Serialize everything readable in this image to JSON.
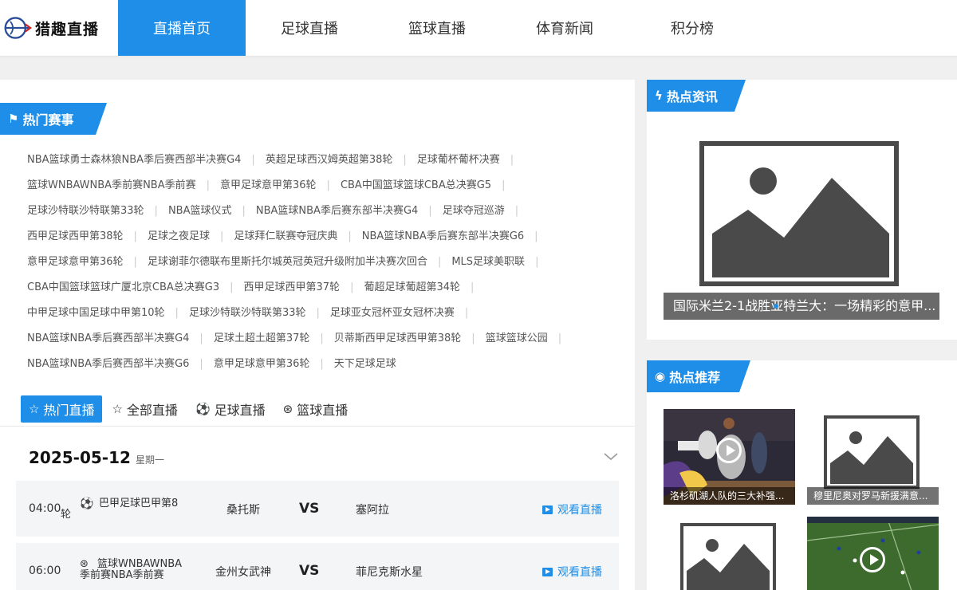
{
  "brand": {
    "name": "猎趣直播",
    "accent": "#1e8ee8"
  },
  "nav": [
    {
      "label": "直播首页",
      "active": true
    },
    {
      "label": "足球直播"
    },
    {
      "label": "篮球直播"
    },
    {
      "label": "体育新闻"
    },
    {
      "label": "积分榜"
    }
  ],
  "hot_events": {
    "title": "热门赛事",
    "lines": [
      [
        "NBA篮球勇士森林狼NBA季后赛西部半决赛G4",
        "英超足球西汉姆英超第38轮",
        "足球葡杯葡杯决赛"
      ],
      [
        "篮球WNBAWNBA季前赛NBA季前赛",
        "意甲足球意甲第36轮",
        "CBA中国篮球篮球CBA总决赛G5"
      ],
      [
        "足球沙特联沙特联第33轮",
        "NBA篮球仪式",
        "NBA篮球NBA季后赛东部半决赛G4",
        "足球夺冠巡游"
      ],
      [
        "西甲足球西甲第38轮",
        "足球之夜足球",
        "足球拜仁联赛夺冠庆典",
        "NBA篮球NBA季后赛东部半决赛G6"
      ],
      [
        "意甲足球意甲第36轮",
        "足球谢菲尔德联布里斯托尔城英冠英冠升级附加半决赛次回合",
        "MLS足球美职联"
      ],
      [
        "CBA中国篮球篮球广厦北京CBA总决赛G3",
        "西甲足球西甲第37轮",
        "葡超足球葡超第34轮"
      ],
      [
        "中甲足球中国足球中甲第10轮",
        "足球沙特联沙特联第33轮",
        "足球亚女冠杯亚女冠杯决赛"
      ],
      [
        "NBA篮球NBA季后赛西部半决赛G4",
        "足球土超土超第37轮",
        "贝蒂斯西甲足球西甲第38轮",
        "篮球篮球公园"
      ],
      [
        "NBA篮球NBA季后赛西部半决赛G6",
        "意甲足球意甲第36轮",
        "天下足球足球"
      ]
    ]
  },
  "tabs": [
    {
      "label": "热门直播",
      "icon": "star-icon",
      "active": true
    },
    {
      "label": "全部直播",
      "icon": "star-outline-icon"
    },
    {
      "label": "足球直播",
      "icon": "soccer-ball-icon"
    },
    {
      "label": "篮球直播",
      "icon": "basketball-icon"
    }
  ],
  "schedule": {
    "date": "2025-05-12",
    "weekday": "星期一",
    "matches": [
      {
        "time": "04:00",
        "league_line1": "巴甲足球巴甲第8",
        "league_line2": "轮",
        "sport_icon": "soccer-ball-icon",
        "home": "桑托斯",
        "vs": "VS",
        "away": "塞阿拉",
        "watch": "观看直播"
      },
      {
        "time": "06:00",
        "league_line1": "篮球WNBAWNBA",
        "league_line2": "季前赛NBA季前赛",
        "sport_icon": "basketball-icon",
        "home": "金州女武神",
        "vs": "VS",
        "away": "菲尼克斯水星",
        "watch": "观看直播"
      }
    ]
  },
  "hot_news": {
    "title": "热点资讯",
    "caption": "国际米兰2-1战胜亚特兰大：一场精彩的意甲..."
  },
  "recommend": {
    "title": "热点推荐",
    "items": [
      {
        "caption": "洛杉矶湖人队的三大补强...",
        "type": "video"
      },
      {
        "caption": "穆里尼奥对罗马新援满意...",
        "type": "placeholder"
      },
      {
        "caption": "",
        "type": "placeholder"
      },
      {
        "caption": "",
        "type": "video"
      }
    ]
  }
}
